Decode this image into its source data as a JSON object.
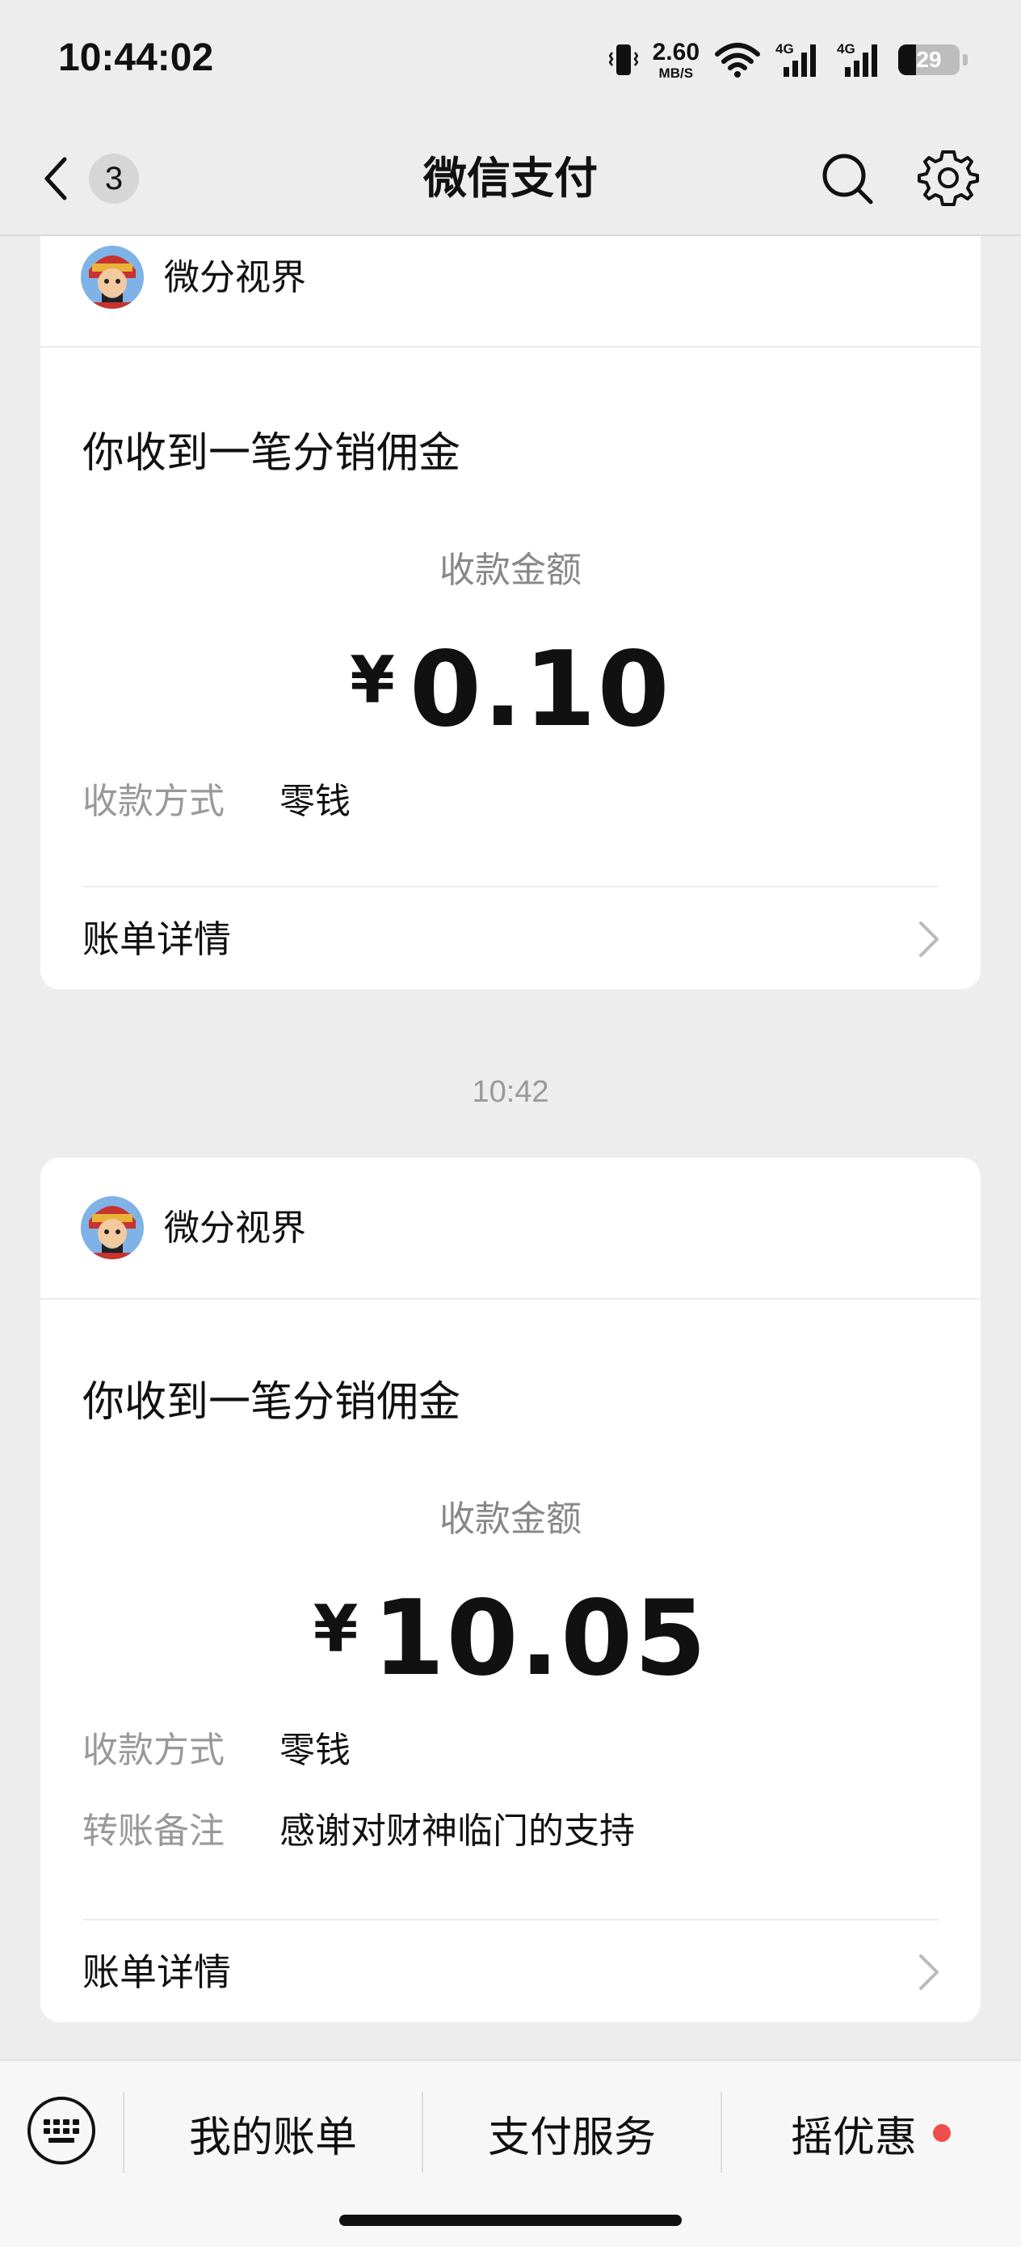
{
  "status_bar": {
    "time": "10:44:02",
    "net_speed_value": "2.60",
    "net_speed_unit": "MB/S",
    "network_1": "4G",
    "network_2": "4G",
    "battery_level": "29",
    "battery_fraction": 0.29
  },
  "nav": {
    "back_badge_count": "3",
    "title": "微信支付",
    "icons": [
      "back-chevron-icon",
      "search-icon",
      "gear-icon"
    ]
  },
  "messages": [
    {
      "merchant": "微分视界",
      "title": "你收到一笔分销佣金",
      "amount_label": "收款金额",
      "currency": "¥",
      "amount": "0.10",
      "rows": [
        {
          "label": "收款方式",
          "value": "零钱"
        }
      ],
      "detail_label": "账单详情"
    },
    {
      "timestamp": "10:42",
      "merchant": "微分视界",
      "title": "你收到一笔分销佣金",
      "amount_label": "收款金额",
      "currency": "¥",
      "amount": "10.05",
      "rows": [
        {
          "label": "收款方式",
          "value": "零钱"
        },
        {
          "label": "转账备注",
          "value": "感谢对财神临门的支持"
        }
      ],
      "detail_label": "账单详情"
    }
  ],
  "bottom_menu": {
    "keyboard_icon": "keyboard-icon",
    "items": [
      "我的账单",
      "支付服务",
      "摇优惠"
    ]
  },
  "colors": {
    "background": "#ededed",
    "card": "#ffffff",
    "muted_text": "#999999",
    "red_dot": "#f04d4d"
  }
}
